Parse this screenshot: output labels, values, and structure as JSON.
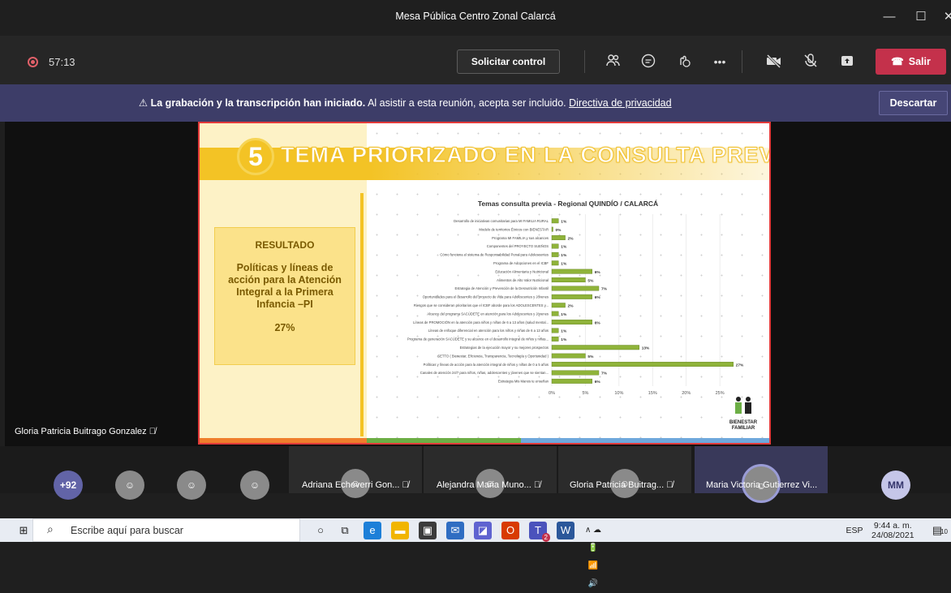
{
  "window": {
    "title": "Mesa Pública Centro Zonal Calarcá"
  },
  "toolbar": {
    "timer": "57:13",
    "request_control": "Solicitar control",
    "leave": "Salir"
  },
  "banner": {
    "bold": "La grabación y la transcripción han iniciado.",
    "text": "Al asistir a esta reunión, acepta ser incluido.",
    "link": "Directiva de privacidad",
    "dismiss": "Descartar"
  },
  "slide": {
    "number": "5",
    "title": "TEMA PRIORIZADO EN LA CONSULTA PREVIA",
    "result_header": "RESULTADO",
    "result_text": "Políticas y líneas de acción para la Atención Integral a la Primera Infancia –PI",
    "result_percent": "27%",
    "logo_text": "BIENESTAR FAMILIAR"
  },
  "chart_data": {
    "type": "bar",
    "orientation": "horizontal",
    "title": "Temas consulta previa - Regional QUINDÍO  / CALARCÁ",
    "categories": [
      "Desarrollo de iniciativas comunitarias para MI FAMILIA RURAL",
      "Modelo de territorios Étnicos con BIENESTAR",
      "Programa MI FAMILIA y sus alcances",
      "Componentes del PROYECTO SUEÑOS",
      "Cómo funciona el sistema de Responsabilidad Penal para Adolescentes",
      "Programa de Adopciones en el ICBF",
      "Educación Alimentaria y Nutricional",
      "Alimentos de Alto Valor Nutricional",
      "Estrategia de Atención y Prevención de la Desnutrición Infantil",
      "Oportunidades para el desarrollo del proyecto de vida para Adolescentes y Jóvenes",
      "Riesgos que se consideran prioritarios que el ICBF aborde para los ADOLESCENTES y...",
      "Alcance del programa SACÚDETE en atención para los Adolescentes y Jóvenes",
      "Líneas de PROMOCIÓN en la atención para niños y niñas de 6 a 13 años (salud mental...",
      "Líneas de enfoque diferencial en atención para los niños y niñas de 6 a 13 años",
      "Programa de generación SACÚDETE y su alcance en el desarrollo integral de niños y niñas...",
      "Estrategias de la ejecución mayor y su mejores prospectos",
      "SETTO ( Bienestar, Eficiencia, Transparencia, Tecnología y Oportunidad )",
      "Políticas y líneas de acción para la atención integral de niños y niñas de 0 a 5 años",
      "Canales de atención 24/7 para niños, niñas, adolescentes y jóvenes que se sientan...",
      "Estrategia Mis Manos te enseñan"
    ],
    "values": [
      1,
      0,
      2,
      1,
      1,
      1,
      6,
      5,
      7,
      6,
      2,
      1,
      6,
      1,
      1,
      13,
      5,
      27,
      7,
      6
    ],
    "data_labels": [
      "1%",
      "0%",
      "2%",
      "1%",
      "1%",
      "1%",
      "6%",
      "5%",
      "7%",
      "6%",
      "2%",
      "1%",
      "6%",
      "1%",
      "1%",
      "13%",
      "5%",
      "27%",
      "7%",
      "6%"
    ],
    "xticks": [
      "0%",
      "5%",
      "10%",
      "15%",
      "20%",
      "25%"
    ],
    "xlim": [
      0,
      28
    ],
    "bar_color": "#8fb33a"
  },
  "speaker": {
    "name": "Gloria Patricia Buitrago Gonzalez"
  },
  "participants": {
    "overflow": "+92",
    "named": [
      "Adriana Echeverri Gon...",
      "Alejandra Maria Muno...",
      "Gloria Patricia Buitrag...",
      "Maria Victoria Gutierrez Vi..."
    ],
    "initials": "MM"
  },
  "taskbar": {
    "search_placeholder": "Escribe aquí para buscar",
    "lang": "ESP",
    "time": "9:44 a. m.",
    "date": "24/08/2021",
    "notif_count": "10",
    "teams_badge": "2"
  }
}
